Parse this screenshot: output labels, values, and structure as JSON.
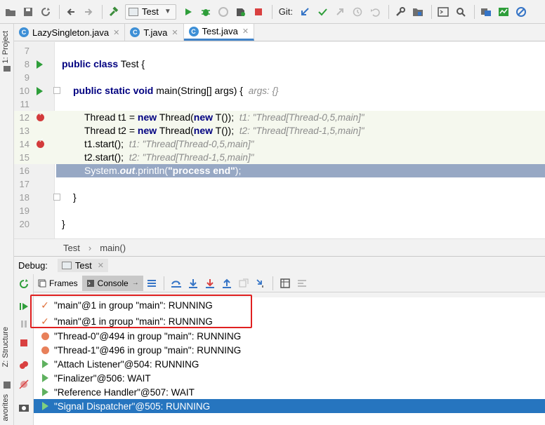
{
  "toolbar": {
    "run_config": "Test",
    "git_label": "Git:"
  },
  "side": {
    "project": "1: Project",
    "structure": "Z: Structure",
    "favorites": "avorites"
  },
  "tabs": [
    {
      "label": "LazySingleton.java"
    },
    {
      "label": "T.java"
    },
    {
      "label": "Test.java"
    }
  ],
  "editor": {
    "line_numbers": [
      "7",
      "8",
      "9",
      "10",
      "11",
      "12",
      "13",
      "14",
      "15",
      "16",
      "17",
      "18",
      "19",
      "20"
    ],
    "l8": {
      "kw": "public class",
      "rest": " Test {"
    },
    "l10": {
      "kw": "public static void",
      "rest": " main(String[] args) {",
      "hint": "args: {}"
    },
    "l12": {
      "pre": "Thread t1 = ",
      "kw1": "new",
      "mid": " Thread(",
      "kw2": "new",
      "post": " T());",
      "hint": "t1: \"Thread[Thread-0,5,main]\""
    },
    "l13": {
      "pre": "Thread t2 = ",
      "kw1": "new",
      "mid": " Thread(",
      "kw2": "new",
      "post": " T());",
      "hint": "t2: \"Thread[Thread-1,5,main]\""
    },
    "l14": {
      "code": "t1.start();",
      "hint": "t1: \"Thread[Thread-0,5,main]\""
    },
    "l15": {
      "code": "t2.start();",
      "hint": "t2: \"Thread[Thread-1,5,main]\""
    },
    "l16": {
      "pre": "System.",
      "out": "out",
      "mid": ".println(",
      "str": "\"process end\"",
      "post": ");"
    },
    "l18": "}",
    "l20": "}"
  },
  "breadcrumb": {
    "cls": "Test",
    "method": "main()"
  },
  "debug": {
    "label": "Debug:",
    "tab": "Test",
    "frames_label": "Frames",
    "console_label": "Console"
  },
  "threads": [
    {
      "icon": "check",
      "text": "\"main\"@1 in group \"main\": RUNNING"
    },
    {
      "icon": "check",
      "text": "\"main\"@1 in group \"main\": RUNNING"
    },
    {
      "icon": "dot",
      "text": "\"Thread-0\"@494 in group \"main\": RUNNING"
    },
    {
      "icon": "dot",
      "text": "\"Thread-1\"@496 in group \"main\": RUNNING"
    },
    {
      "icon": "play",
      "text": "\"Attach Listener\"@504: RUNNING"
    },
    {
      "icon": "play",
      "text": "\"Finalizer\"@506: WAIT"
    },
    {
      "icon": "play",
      "text": "\"Reference Handler\"@507: WAIT"
    },
    {
      "icon": "play",
      "text": "\"Signal Dispatcher\"@505: RUNNING"
    }
  ],
  "colors": {
    "accent": "#2675bf",
    "highlight_box": "#e02020",
    "current_line": "#97a8c4"
  }
}
